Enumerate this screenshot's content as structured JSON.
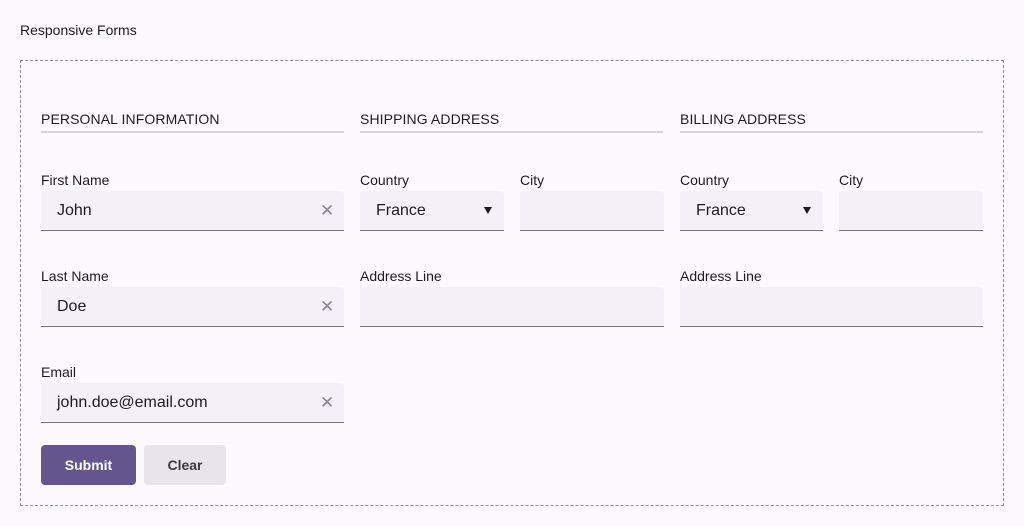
{
  "page": {
    "title": "Responsive Forms"
  },
  "sections": {
    "personal": "PERSONAL INFORMATION",
    "shipping": "SHIPPING ADDRESS",
    "billing": "BILLING ADDRESS"
  },
  "personal": {
    "first_name": {
      "label": "First Name",
      "value": "John"
    },
    "last_name": {
      "label": "Last Name",
      "value": "Doe"
    },
    "email": {
      "label": "Email",
      "value": "john.doe@email.com"
    }
  },
  "shipping": {
    "country": {
      "label": "Country",
      "value": "France"
    },
    "city": {
      "label": "City",
      "value": ""
    },
    "address": {
      "label": "Address Line",
      "value": ""
    }
  },
  "billing": {
    "country": {
      "label": "Country",
      "value": "France"
    },
    "city": {
      "label": "City",
      "value": ""
    },
    "address": {
      "label": "Address Line",
      "value": ""
    }
  },
  "actions": {
    "submit": "Submit",
    "clear": "Clear"
  },
  "icons": {
    "clear": "close-icon",
    "dropdown": "caret-down-icon"
  },
  "colors": {
    "primary": "#65558f",
    "field_bg": "#f3f0f7",
    "secondary_btn": "#e8e4ec"
  }
}
